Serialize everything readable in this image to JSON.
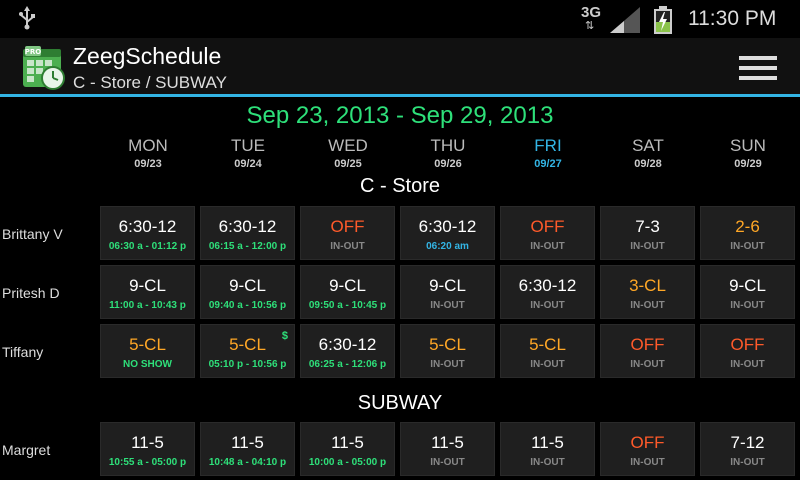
{
  "status": {
    "network": "3G",
    "time": "11:30 PM"
  },
  "app": {
    "title": "ZeegSchedule",
    "subtitle": "C - Store / SUBWAY",
    "icon_badge": "PRO"
  },
  "week": {
    "range": "Sep 23, 2013 - Sep 29, 2013",
    "days": [
      {
        "name": "MON",
        "date": "09/23"
      },
      {
        "name": "TUE",
        "date": "09/24"
      },
      {
        "name": "WED",
        "date": "09/25"
      },
      {
        "name": "THU",
        "date": "09/26"
      },
      {
        "name": "FRI",
        "date": "09/27",
        "today": true
      },
      {
        "name": "SAT",
        "date": "09/28"
      },
      {
        "name": "SUN",
        "date": "09/29"
      }
    ]
  },
  "sections": [
    {
      "title": "C - Store",
      "employees": [
        {
          "name": "Brittany V",
          "cells": [
            {
              "shift": "6:30-12",
              "shift_color": "white",
              "sub": "06:30 a - 01:12 p",
              "sub_color": "green"
            },
            {
              "shift": "6:30-12",
              "shift_color": "white",
              "sub": "06:15 a - 12:00 p",
              "sub_color": "green"
            },
            {
              "shift": "OFF",
              "shift_color": "red",
              "sub": "IN-OUT",
              "sub_color": "gray"
            },
            {
              "shift": "6:30-12",
              "shift_color": "white",
              "sub": "06:20 am",
              "sub_color": "blue"
            },
            {
              "shift": "OFF",
              "shift_color": "red",
              "sub": "IN-OUT",
              "sub_color": "gray"
            },
            {
              "shift": "7-3",
              "shift_color": "white",
              "sub": "IN-OUT",
              "sub_color": "gray"
            },
            {
              "shift": "2-6",
              "shift_color": "orange",
              "sub": "IN-OUT",
              "sub_color": "gray"
            }
          ]
        },
        {
          "name": "Pritesh D",
          "cells": [
            {
              "shift": "9-CL",
              "shift_color": "white",
              "sub": "11:00 a - 10:43 p",
              "sub_color": "green"
            },
            {
              "shift": "9-CL",
              "shift_color": "white",
              "sub": "09:40 a - 10:56 p",
              "sub_color": "green"
            },
            {
              "shift": "9-CL",
              "shift_color": "white",
              "sub": "09:50 a - 10:45 p",
              "sub_color": "green"
            },
            {
              "shift": "9-CL",
              "shift_color": "white",
              "sub": "IN-OUT",
              "sub_color": "gray"
            },
            {
              "shift": "6:30-12",
              "shift_color": "white",
              "sub": "IN-OUT",
              "sub_color": "gray"
            },
            {
              "shift": "3-CL",
              "shift_color": "orange",
              "sub": "IN-OUT",
              "sub_color": "gray"
            },
            {
              "shift": "9-CL",
              "shift_color": "white",
              "sub": "IN-OUT",
              "sub_color": "gray"
            }
          ]
        },
        {
          "name": "Tiffany",
          "cells": [
            {
              "shift": "5-CL",
              "shift_color": "orange",
              "sub": "NO SHOW",
              "sub_color": "green"
            },
            {
              "shift": "5-CL",
              "shift_color": "orange",
              "sub": "05:10 p - 10:56 p",
              "sub_color": "green",
              "mark": "$"
            },
            {
              "shift": "6:30-12",
              "shift_color": "white",
              "sub": "06:25 a - 12:06 p",
              "sub_color": "green"
            },
            {
              "shift": "5-CL",
              "shift_color": "orange",
              "sub": "IN-OUT",
              "sub_color": "gray"
            },
            {
              "shift": "5-CL",
              "shift_color": "orange",
              "sub": "IN-OUT",
              "sub_color": "gray"
            },
            {
              "shift": "OFF",
              "shift_color": "red",
              "sub": "IN-OUT",
              "sub_color": "gray"
            },
            {
              "shift": "OFF",
              "shift_color": "red",
              "sub": "IN-OUT",
              "sub_color": "gray"
            }
          ]
        }
      ]
    },
    {
      "title": "SUBWAY",
      "employees": [
        {
          "name": "Margret",
          "cells": [
            {
              "shift": "11-5",
              "shift_color": "white",
              "sub": "10:55 a - 05:00 p",
              "sub_color": "green"
            },
            {
              "shift": "11-5",
              "shift_color": "white",
              "sub": "10:48 a - 04:10 p",
              "sub_color": "green"
            },
            {
              "shift": "11-5",
              "shift_color": "white",
              "sub": "10:00 a - 05:00 p",
              "sub_color": "green"
            },
            {
              "shift": "11-5",
              "shift_color": "white",
              "sub": "IN-OUT",
              "sub_color": "gray"
            },
            {
              "shift": "11-5",
              "shift_color": "white",
              "sub": "IN-OUT",
              "sub_color": "gray"
            },
            {
              "shift": "OFF",
              "shift_color": "red",
              "sub": "IN-OUT",
              "sub_color": "gray"
            },
            {
              "shift": "7-12",
              "shift_color": "white",
              "sub": "IN-OUT",
              "sub_color": "gray"
            }
          ]
        }
      ]
    }
  ],
  "colors": {
    "accent": "#33b5e5",
    "green": "#2ee07a",
    "orange": "#ffa726",
    "red": "#ff5a2a",
    "gray": "#888888",
    "cell_bg": "#1f1f1f"
  },
  "icons": {
    "usb": "usb-icon",
    "signal": "signal-icon",
    "battery": "battery-charging-icon",
    "app": "calendar-clock-icon",
    "menu": "overflow-menu-icon"
  }
}
